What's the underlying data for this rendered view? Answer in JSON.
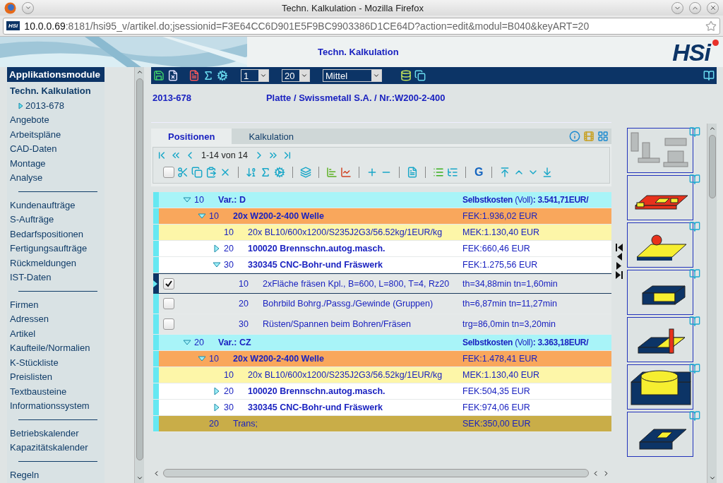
{
  "window": {
    "title": "Techn. Kalkulation - Mozilla Firefox"
  },
  "url": {
    "host": "10.0.0.69",
    "rest": ":8181/hsi95_v/artikel.do;jsessionid=F3E64CC6D901E5F9BC9903386D1CE64D?action=edit&modul=B040&keyART=20",
    "site_badge": "HSi"
  },
  "header": {
    "title": "Techn. Kalkulation",
    "logo": "HSi"
  },
  "sidebar": {
    "title": "Applikationsmodule",
    "groups": [
      {
        "items": [
          {
            "label": "Techn. Kalkulation",
            "selected": true,
            "children": [
              {
                "label": "2013-678",
                "selected": false
              }
            ]
          },
          {
            "label": "Angebote",
            "selected": false
          },
          {
            "label": "Arbeitspläne",
            "selected": false
          },
          {
            "label": "CAD-Daten",
            "selected": false
          },
          {
            "label": "Montage",
            "selected": false
          },
          {
            "label": "Analyse",
            "selected": false
          }
        ]
      },
      {
        "items": [
          {
            "label": "Kundenaufträge",
            "selected": false
          },
          {
            "label": "S-Aufträge",
            "selected": false
          },
          {
            "label": "Bedarfspositionen",
            "selected": false
          },
          {
            "label": "Fertigungsaufträge",
            "selected": false
          },
          {
            "label": "Rückmeldungen",
            "selected": false
          },
          {
            "label": "IST-Daten",
            "selected": false
          }
        ]
      },
      {
        "items": [
          {
            "label": "Firmen",
            "selected": false
          },
          {
            "label": "Adressen",
            "selected": false
          },
          {
            "label": "Artikel",
            "selected": false
          },
          {
            "label": "Kaufteile/Normalien",
            "selected": false
          },
          {
            "label": "K-Stückliste",
            "selected": false
          },
          {
            "label": "Preislisten",
            "selected": false
          },
          {
            "label": "Textbausteine",
            "selected": false
          },
          {
            "label": "Informationssystem",
            "selected": false
          }
        ]
      },
      {
        "items": [
          {
            "label": "Betriebskalender",
            "selected": false
          },
          {
            "label": "Kapazitätskalender",
            "selected": false
          }
        ]
      },
      {
        "items": [
          {
            "label": "Regeln",
            "selected": false
          }
        ]
      }
    ]
  },
  "toolbar": {
    "selects": [
      {
        "value": "1"
      },
      {
        "value": "20"
      },
      {
        "value": "Mittel"
      }
    ]
  },
  "record": {
    "number": "2013-678",
    "description": "Platte / Swissmetall S.A. / Nr.:W200-2-400"
  },
  "tabs": [
    {
      "label": "Positionen",
      "selected": true
    },
    {
      "label": "Kalkulation",
      "selected": false
    }
  ],
  "pager": {
    "range": "1-14 von 14"
  },
  "actions": {
    "select_all": {
      "checked": false
    },
    "g_button": "G"
  },
  "tree": [
    {
      "kind": "variant",
      "expanded": true,
      "number": "10",
      "text": "Var.: D",
      "cost": "**Selbstkosten** (Voll)**: 3.541,71EUR/**",
      "children": [
        {
          "kind": "article",
          "expanded": true,
          "number": "10",
          "text": "20x W200-2-400 Welle",
          "cost": "FEK:1.936,02 EUR",
          "children": [
            {
              "kind": "material",
              "number": "10",
              "text": "20x BL10/600x1200/S235J2G3/56.52kg/1EUR/kg",
              "cost": "MEK:1.130,40 EUR"
            },
            {
              "kind": "operation",
              "expanded": false,
              "number": "20",
              "text": "100020 Brennschn.autog.masch.",
              "cost": "FEK:660,46 EUR"
            },
            {
              "kind": "operation",
              "expanded": true,
              "number": "30",
              "text": "330345 CNC-Bohr-und Fräswerk",
              "cost": "FEK:1.275,56 EUR",
              "children": [
                {
                  "kind": "step",
                  "checked": true,
                  "selected": true,
                  "number": "10",
                  "text": "2xFläche fräsen Kpl., B=600, L=800, T=4, Rz20",
                  "cost": "th=34,88min tn=1,60min"
                },
                {
                  "kind": "step",
                  "checked": false,
                  "selected": false,
                  "number": "20",
                  "text": "Bohrbild Bohrg./Passg./Gewinde (Gruppen)",
                  "cost": "th=6,87min tn=11,27min"
                },
                {
                  "kind": "step",
                  "checked": false,
                  "selected": false,
                  "number": "30",
                  "text": "Rüsten/Spannen beim Bohren/Fräsen",
                  "cost": "trg=86,0min tn=3,20min"
                }
              ]
            }
          ]
        }
      ]
    },
    {
      "kind": "variant",
      "expanded": true,
      "number": "20",
      "text": "Var.: CZ",
      "cost": "**Selbstkosten** (Voll)**: 3.363,18EUR/**",
      "children": [
        {
          "kind": "article",
          "expanded": true,
          "number": "10",
          "text": "20x W200-2-400 Welle",
          "cost": "FEK:1.478,41 EUR",
          "children": [
            {
              "kind": "material",
              "number": "10",
              "text": "20x BL10/600x1200/S235J2G3/56.52kg/1EUR/kg",
              "cost": "MEK:1.130,40 EUR"
            },
            {
              "kind": "operation",
              "expanded": false,
              "number": "20",
              "text": "100020 Brennschn.autog.masch.",
              "cost": "FEK:504,35 EUR"
            },
            {
              "kind": "operation",
              "expanded": false,
              "number": "30",
              "text": "330345 CNC-Bohr-und Fräswerk",
              "cost": "FEK:974,06 EUR"
            }
          ]
        },
        {
          "kind": "trans",
          "number": "20",
          "text": "Trans;",
          "cost": "SEK:350,00 EUR"
        }
      ]
    }
  ],
  "thumbnails": [
    {
      "kind": "machines"
    },
    {
      "kind": "frame-plate"
    },
    {
      "kind": "plate-knob"
    },
    {
      "kind": "block"
    },
    {
      "kind": "block-pin"
    },
    {
      "kind": "cylinder"
    },
    {
      "kind": "pocket"
    }
  ]
}
